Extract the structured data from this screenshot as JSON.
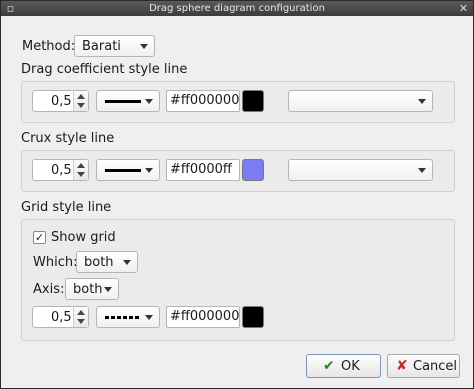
{
  "window": {
    "title": "Drag sphere diagram configuration",
    "menu_icon": "▫",
    "close_icon": "✕"
  },
  "method": {
    "label": "Method:",
    "value": "Barati"
  },
  "drag_line": {
    "heading": "Drag coefficient style line",
    "width": "0,5",
    "color_text": "#ff000000",
    "swatch_color": "#000000",
    "extra_value": ""
  },
  "crux_line": {
    "heading": "Crux style line",
    "width": "0,5",
    "color_text": "#ff0000ff",
    "swatch_color": "#7b7bf2",
    "extra_value": ""
  },
  "grid_line": {
    "heading": "Grid style line",
    "show_grid_label": "Show grid",
    "show_grid_checked": true,
    "check_mark": "✓",
    "which_label": "Which:",
    "which_value": "both",
    "axis_label": "Axis:",
    "axis_value": "both",
    "width": "0,5",
    "color_text": "#ff000000",
    "swatch_color": "#000000"
  },
  "buttons": {
    "ok_label": "OK",
    "ok_icon": "✔",
    "cancel_label": "Cancel",
    "cancel_icon": "✘"
  }
}
